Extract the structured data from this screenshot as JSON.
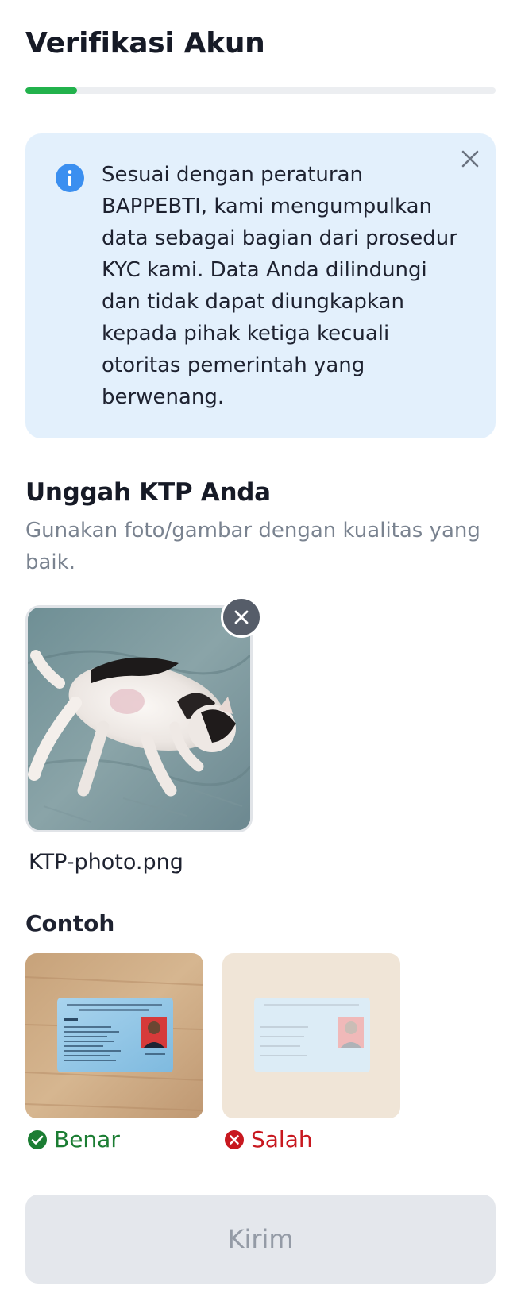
{
  "header": {
    "title": "Verifikasi Akun",
    "progress_fraction": 0.11,
    "progress_color": "#22b24c"
  },
  "info_banner": {
    "icon": "info-icon",
    "close_icon": "close-icon",
    "text": "Sesuai dengan peraturan BAPPEBTI, kami mengumpulkan data sebagai bagian dari prosedur KYC kami. Data Anda dilindungi dan tidak dapat diungkapkan kepada pihak ketiga kecuali otoritas pemerintah yang berwenang.",
    "background": "#e3f0fc",
    "icon_color": "#3b8ff0"
  },
  "upload": {
    "title": "Unggah KTP Anda",
    "subtitle": "Gunakan foto/gambar dengan kualitas yang baik.",
    "file_name": "KTP-photo.png",
    "remove_icon": "close-icon"
  },
  "examples": {
    "title": "Contoh",
    "items": [
      {
        "label": "Benar",
        "status": "correct",
        "icon": "check-circle-icon",
        "color": "#1b7d33"
      },
      {
        "label": "Salah",
        "status": "wrong",
        "icon": "x-circle-icon",
        "color": "#c8181f"
      }
    ]
  },
  "submit": {
    "label": "Kirim",
    "disabled": true
  }
}
